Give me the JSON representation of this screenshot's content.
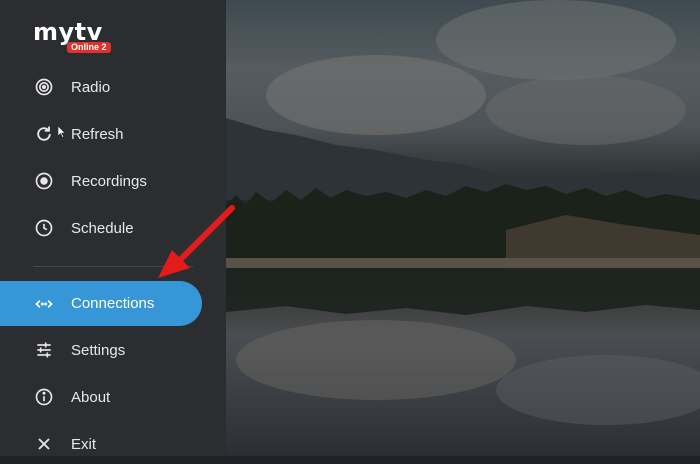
{
  "app": {
    "logo_text": "mytv",
    "logo_badge": "Online 2"
  },
  "menu": {
    "items": [
      {
        "label": "Radio",
        "icon": "radio-icon"
      },
      {
        "label": "Refresh",
        "icon": "refresh-icon"
      },
      {
        "label": "Recordings",
        "icon": "recordings-icon"
      },
      {
        "label": "Schedule",
        "icon": "schedule-icon"
      },
      {
        "label": "Connections",
        "icon": "connections-icon",
        "active": true
      },
      {
        "label": "Settings",
        "icon": "settings-icon"
      },
      {
        "label": "About",
        "icon": "about-icon"
      },
      {
        "label": "Exit",
        "icon": "exit-icon"
      }
    ]
  },
  "colors": {
    "sidebar_bg": "#2b2d31",
    "active_bg": "#3796d8",
    "badge_bg": "#e0312f",
    "annotation_arrow": "#e31b1b"
  }
}
